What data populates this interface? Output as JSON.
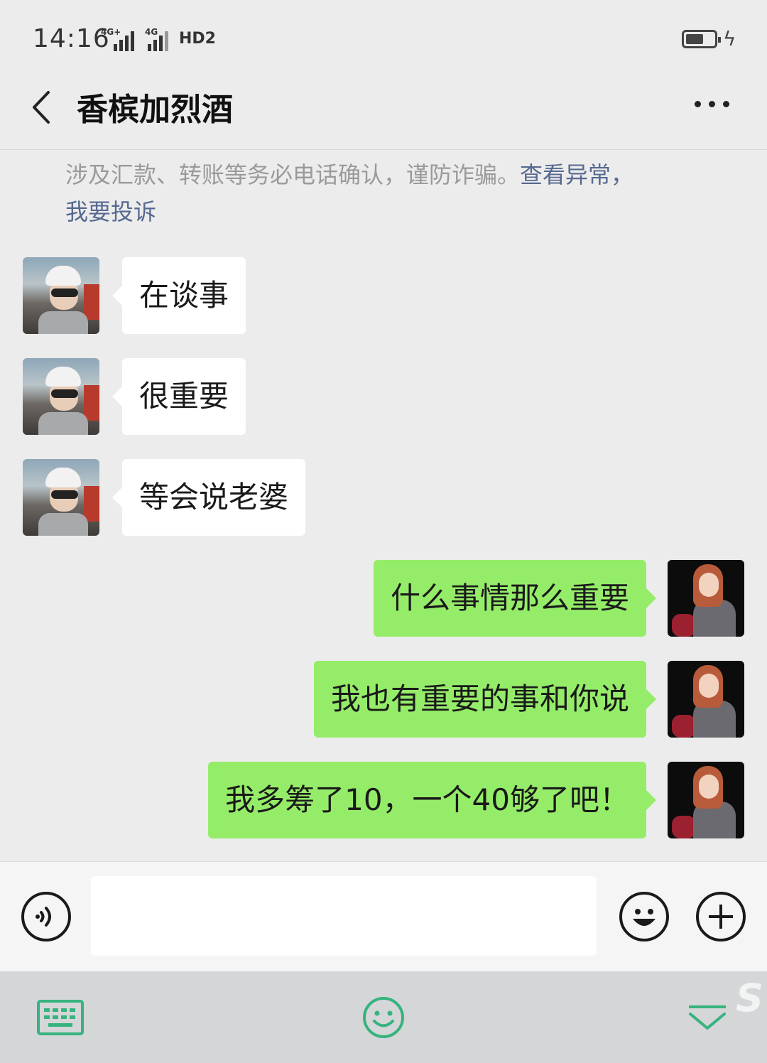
{
  "status_bar": {
    "time": "14:16",
    "network_1": "4G+",
    "network_2": "4G",
    "hd": "HD2"
  },
  "header": {
    "title": "香槟加烈酒"
  },
  "notice": {
    "text": "涉及汇款、转账等务必电话确认，谨防诈骗。",
    "link1": "查看异常，",
    "link2": "我要投诉"
  },
  "messages": [
    {
      "side": "in",
      "text": "在谈事"
    },
    {
      "side": "in",
      "text": "很重要"
    },
    {
      "side": "in",
      "text": "等会说老婆"
    },
    {
      "side": "out",
      "text": "什么事情那么重要"
    },
    {
      "side": "out",
      "text": "我也有重要的事和你说"
    },
    {
      "side": "out",
      "text": "我多筹了10，一个40够了吧！"
    }
  ],
  "input": {
    "value": ""
  },
  "colors": {
    "outgoing_bubble": "#95ec69",
    "incoming_bubble": "#ffffff",
    "keyboard_accent": "#36b37e"
  },
  "icons": {
    "voice": "voice-icon",
    "emoji": "emoji-icon",
    "plus": "plus-icon",
    "keyboard": "keyboard-icon",
    "collapse": "chevron-down-icon"
  }
}
